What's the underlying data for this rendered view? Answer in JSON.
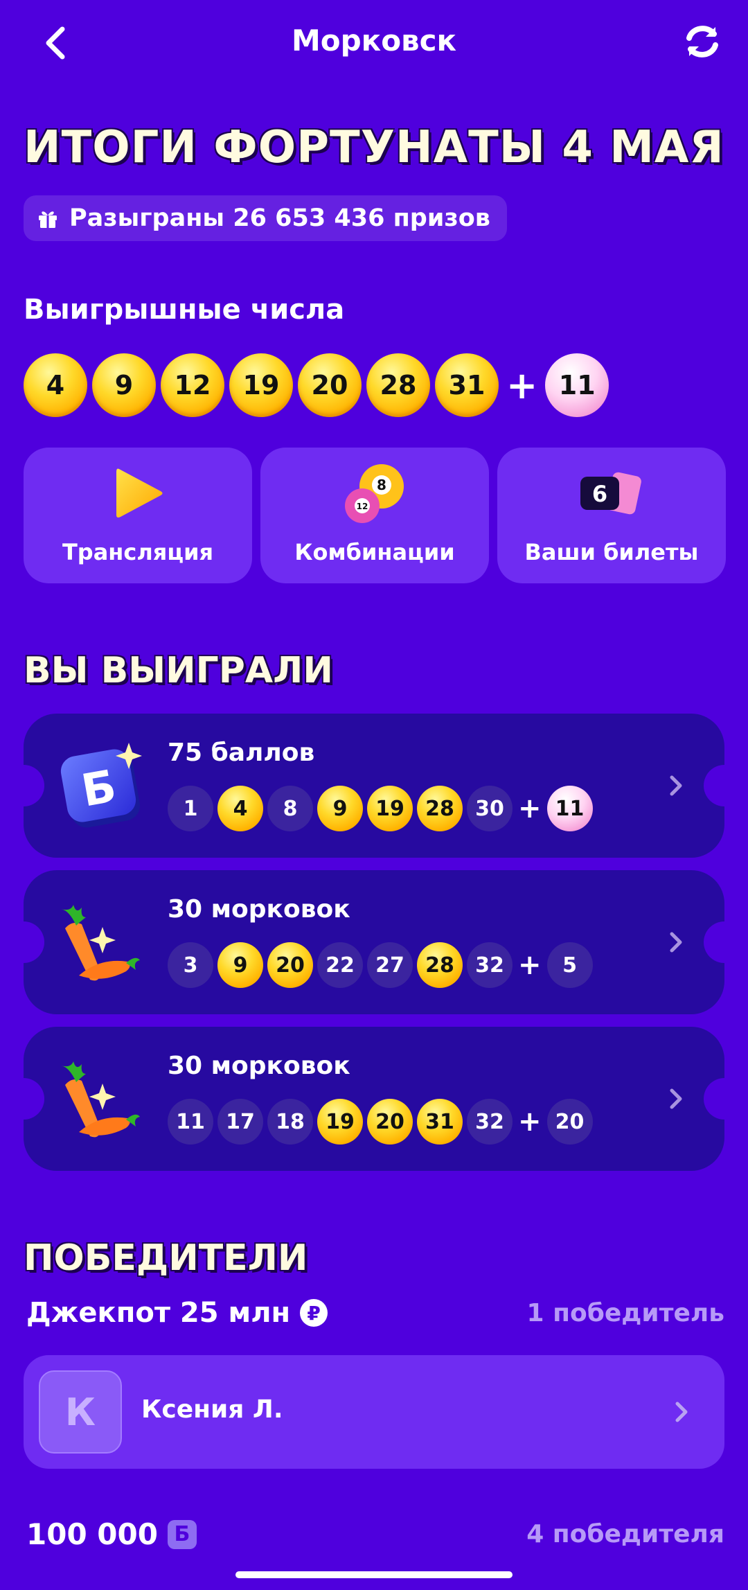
{
  "header": {
    "title": "Морковск"
  },
  "results": {
    "title": "ИТОГИ ФОРТУНАТЫ 4 МАЯ",
    "prizes_text": "Разыграны 26 653 436 призов",
    "winning_label": "Выигрышные числа",
    "winning_numbers": [
      "4",
      "9",
      "12",
      "19",
      "20",
      "28",
      "31"
    ],
    "bonus_number": "11",
    "plus": "+"
  },
  "actions": [
    {
      "label": "Трансляция",
      "icon": "play-icon"
    },
    {
      "label": "Комбинации",
      "icon": "lottery-balls-icon"
    },
    {
      "label": "Ваши билеты",
      "icon": "tickets-icon",
      "badge": "6"
    }
  ],
  "won": {
    "heading": "ВЫ ВЫИГРАЛИ",
    "tickets": [
      {
        "prize": "75 баллов",
        "icon": "b-points-icon",
        "numbers": [
          {
            "n": "1",
            "hit": false
          },
          {
            "n": "4",
            "hit": true
          },
          {
            "n": "8",
            "hit": false
          },
          {
            "n": "9",
            "hit": true
          },
          {
            "n": "19",
            "hit": true
          },
          {
            "n": "28",
            "hit": true
          },
          {
            "n": "30",
            "hit": false
          }
        ],
        "bonus": {
          "n": "11",
          "hit": true
        }
      },
      {
        "prize": "30 морковок",
        "icon": "carrots-icon",
        "numbers": [
          {
            "n": "3",
            "hit": false
          },
          {
            "n": "9",
            "hit": true
          },
          {
            "n": "20",
            "hit": true
          },
          {
            "n": "22",
            "hit": false
          },
          {
            "n": "27",
            "hit": false
          },
          {
            "n": "28",
            "hit": true
          },
          {
            "n": "32",
            "hit": false
          }
        ],
        "bonus": {
          "n": "5",
          "hit": false
        }
      },
      {
        "prize": "30 морковок",
        "icon": "carrots-icon",
        "numbers": [
          {
            "n": "11",
            "hit": false
          },
          {
            "n": "17",
            "hit": false
          },
          {
            "n": "18",
            "hit": false
          },
          {
            "n": "19",
            "hit": true
          },
          {
            "n": "20",
            "hit": true
          },
          {
            "n": "31",
            "hit": true
          },
          {
            "n": "32",
            "hit": false
          }
        ],
        "bonus": {
          "n": "20",
          "hit": false
        }
      }
    ]
  },
  "winners": {
    "heading": "ПОБЕДИТЕЛИ",
    "jackpot": {
      "title": "Джекпот 25 млн",
      "currency": "₽",
      "count": "1 победитель"
    },
    "jackpot_winner": {
      "initial": "К",
      "name": "Ксения Л."
    },
    "next_prize": {
      "amount": "100 000",
      "currency_badge": "Б",
      "count": "4 победителя"
    }
  },
  "colors": {
    "background": "#4f00dd",
    "card": "#6f2cf2",
    "ticket": "#270aa0",
    "gold": "#ffc400",
    "pink": "#f59ad6"
  }
}
